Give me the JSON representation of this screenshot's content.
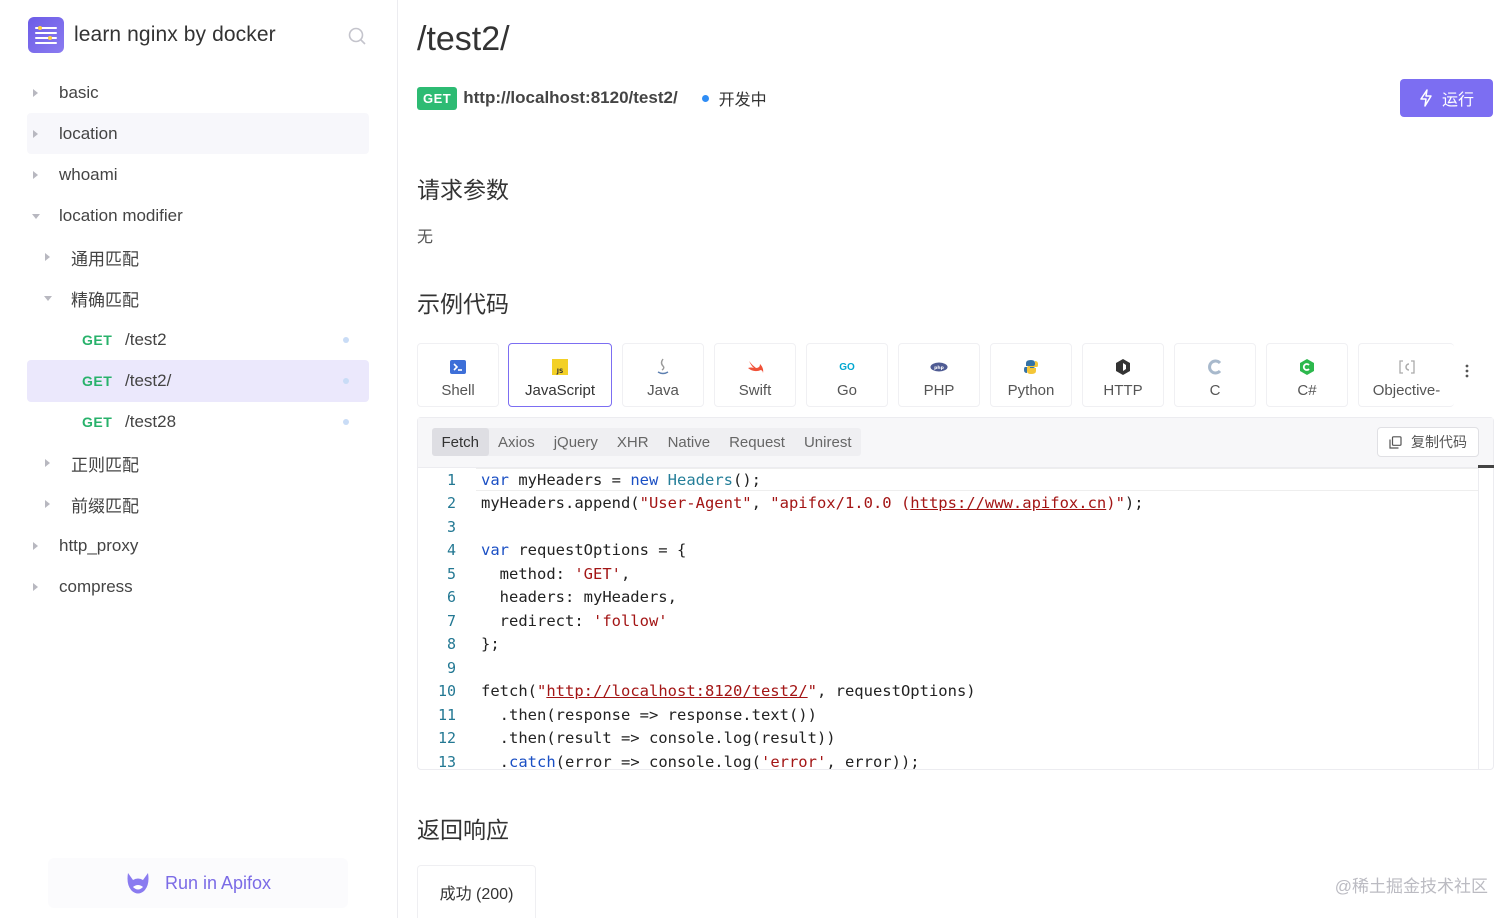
{
  "sidebar": {
    "title": "learn nginx by docker",
    "items": [
      {
        "label": "basic"
      },
      {
        "label": "location"
      },
      {
        "label": "whoami"
      },
      {
        "label": "location modifier"
      },
      {
        "label": "通用匹配"
      },
      {
        "label": "精确匹配"
      },
      {
        "method": "GET",
        "path": "/test2"
      },
      {
        "method": "GET",
        "path": "/test2/"
      },
      {
        "method": "GET",
        "path": "/test28"
      },
      {
        "label": "正则匹配"
      },
      {
        "label": "前缀匹配"
      },
      {
        "label": "http_proxy"
      },
      {
        "label": "compress"
      }
    ],
    "run_in_apifox": "Run in Apifox"
  },
  "main": {
    "title": "/test2/",
    "method": "GET",
    "url": "http://localhost:8120/test2/",
    "status": "开发中",
    "run_label": "运行",
    "params_title": "请求参数",
    "params_value": "无",
    "examples_title": "示例代码",
    "lang_tabs": [
      {
        "label": "Shell"
      },
      {
        "label": "JavaScript"
      },
      {
        "label": "Java"
      },
      {
        "label": "Swift"
      },
      {
        "label": "Go"
      },
      {
        "label": "PHP"
      },
      {
        "label": "Python"
      },
      {
        "label": "HTTP"
      },
      {
        "label": "C"
      },
      {
        "label": "C#"
      },
      {
        "label": "Objective-"
      }
    ],
    "lib_tabs": [
      "Fetch",
      "Axios",
      "jQuery",
      "XHR",
      "Native",
      "Request",
      "Unirest"
    ],
    "copy_label": "复制代码",
    "line_numbers": [
      "1",
      "2",
      "3",
      "4",
      "5",
      "6",
      "7",
      "8",
      "9",
      "10",
      "11",
      "12",
      "13"
    ],
    "code": {
      "l1_kw": "var",
      "l1_a": " myHeaders = ",
      "l1_kw2": "new",
      "l1_ty": " Headers",
      "l1_b": "();",
      "l2_a": "myHeaders.append(",
      "l2_s1": "\"User-Agent\"",
      "l2_b": ", ",
      "l2_s2": "\"apifox/1.0.0 (",
      "l2_url": "https://www.apifox.cn",
      "l2_s3": ")\"",
      "l2_c": ");",
      "l4_kw": "var",
      "l4_a": " requestOptions = {",
      "l5_a": "  method: ",
      "l5_s": "'GET'",
      "l5_b": ",",
      "l6_a": "  headers: myHeaders,",
      "l7_a": "  redirect: ",
      "l7_s": "'follow'",
      "l8_a": "};",
      "l10_a": "fetch(",
      "l10_s1": "\"",
      "l10_url": "http://localhost:8120/test2/",
      "l10_s2": "\"",
      "l10_b": ", requestOptions)",
      "l11_a": "  .then(response => response.text())",
      "l12_a": "  .then(result => console.log(result))",
      "l13_a": "  .",
      "l13_kw": "catch",
      "l13_b": "(error => console.log(",
      "l13_s": "'error'",
      "l13_c": ", error));"
    },
    "response_title": "返回响应",
    "response_tab": "成功 (200)",
    "watermark": "@稀土掘金技术社区"
  },
  "colors": {
    "accent": "#7c6ef2",
    "get": "#2dbb73",
    "status": "#2f8df5"
  }
}
